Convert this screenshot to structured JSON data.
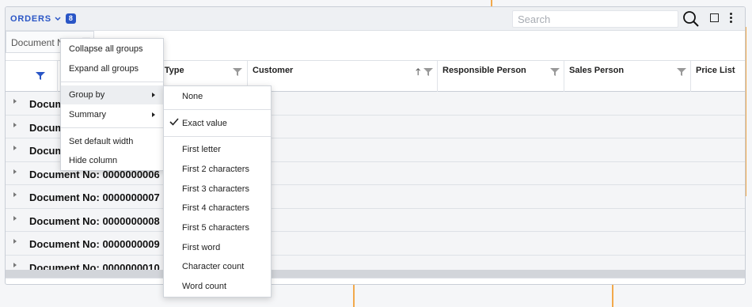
{
  "panel": {
    "title": "ORDERS",
    "count": "8",
    "search_placeholder": "Search"
  },
  "group_chip": {
    "label": "Document N"
  },
  "columns": {
    "document_type": "t Type",
    "customer": "Customer",
    "responsible_person": "Responsible Person",
    "sales_person": "Sales Person",
    "price_list": "Price List"
  },
  "groups": [
    "Document No: 0000000003",
    "Document No: 0000000004",
    "Document No: 0000000005",
    "Document No: 0000000006",
    "Document No: 0000000007",
    "Document No: 0000000008",
    "Document No: 0000000009",
    "Document No: 0000000010"
  ],
  "column_menu": {
    "collapse_all": "Collapse all groups",
    "expand_all": "Expand all groups",
    "group_by": "Group by",
    "summary": "Summary",
    "set_default_width": "Set default width",
    "hide_column": "Hide column"
  },
  "group_by_menu": {
    "none": "None",
    "exact_value": "Exact value",
    "first_letter": "First letter",
    "first_2": "First 2 characters",
    "first_3": "First 3 characters",
    "first_4": "First 4 characters",
    "first_5": "First 5 characters",
    "first_word": "First word",
    "character_count": "Character count",
    "word_count": "Word count",
    "selected": "Exact value"
  },
  "colors": {
    "accent": "#2a56c6",
    "connector": "#f2a94b"
  },
  "icons": [
    "chevron-down-icon",
    "search-icon",
    "square-icon",
    "more-vertical-icon",
    "filter-icon",
    "sort-up-icon",
    "caret-right-icon",
    "check-icon"
  ]
}
